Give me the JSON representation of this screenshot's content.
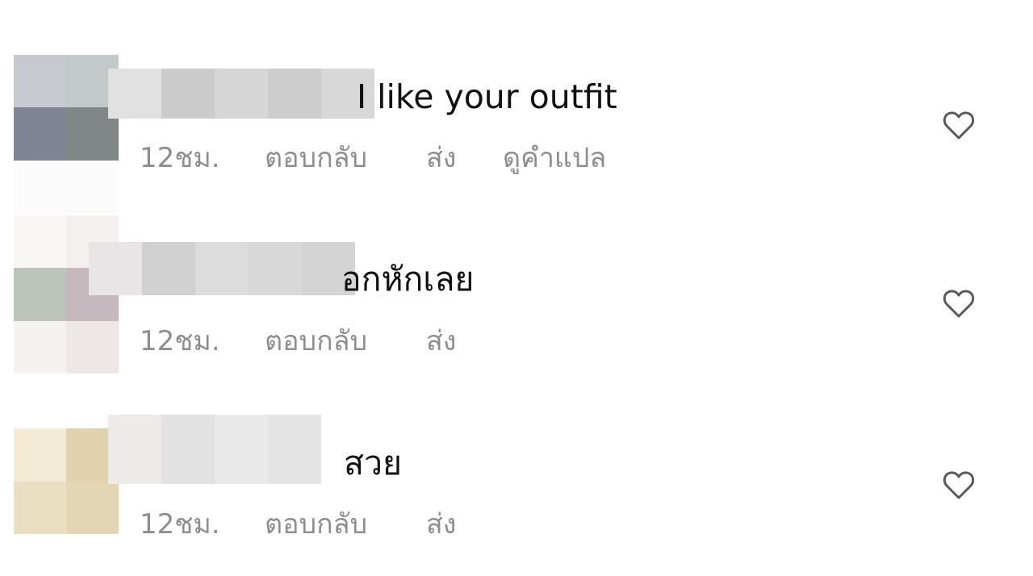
{
  "comments": [
    {
      "text": "I like your outfit",
      "time": "12ชม.",
      "reply": "ตอบกลับ",
      "send": "ส่ง",
      "translate": "ดูคำแปล",
      "avatar_colors": [
        "#c6c9d0",
        "#c3c8c8",
        "#808393",
        "#808786",
        "#fbfbfc",
        "#fbfbfc"
      ],
      "username_colors": [
        "#e1e1e1",
        "#cbcbcb",
        "#d6d6d6",
        "#cdcdcd",
        "#d8d8d8"
      ]
    },
    {
      "text": "อกหักเลย",
      "time": "12ชม.",
      "reply": "ตอบกลับ",
      "send": "ส่ง",
      "avatar_colors": [
        "#f8f7f3",
        "#f4f0ef",
        "#bcc4bb",
        "#c6b9be",
        "#f3f2f1",
        "#ede8e5"
      ],
      "username_colors": [
        "#e9e5e7",
        "#d0d0d0",
        "#dcdcdc",
        "#d8d8d8",
        "#d4d4d4"
      ]
    },
    {
      "text": "สวย",
      "time": "12ชม.",
      "reply": "ตอบกลับ",
      "send": "ส่ง",
      "avatar_colors": [
        "#ffffff",
        "#ffffff",
        "#f2ead5",
        "#e0d2ac",
        "#eadfc2",
        "#e3d6b4"
      ],
      "username_colors": [
        "#ecebe8",
        "#e2e2e2",
        "#e9e9e9",
        "#e4e4e4",
        "#ffffff"
      ]
    }
  ],
  "like_icon": "heart-outline-icon",
  "colors": {
    "meta_text": "#8e8e8e",
    "heart_stroke": "#5a5a5a"
  }
}
